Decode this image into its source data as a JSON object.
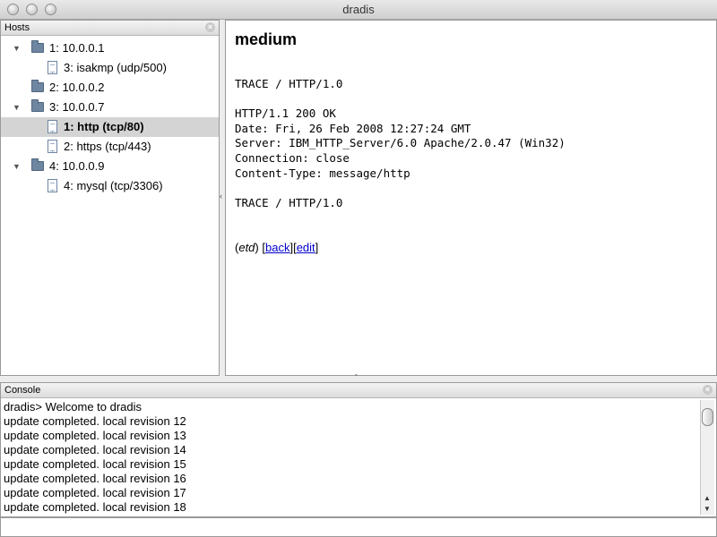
{
  "window": {
    "title": "dradis"
  },
  "hosts_panel": {
    "header": "Hosts",
    "tree": [
      {
        "label": "1: 10.0.0.1",
        "type": "folder",
        "level": 0,
        "expanded": true
      },
      {
        "label": "3: isakmp (udp/500)",
        "type": "doc",
        "level": 1
      },
      {
        "label": "2: 10.0.0.2",
        "type": "folder",
        "level": 0,
        "expanded": false
      },
      {
        "label": "3: 10.0.0.7",
        "type": "folder",
        "level": 0,
        "expanded": true
      },
      {
        "label": "1: http (tcp/80)",
        "type": "doc",
        "level": 1,
        "selected": true
      },
      {
        "label": "2: https (tcp/443)",
        "type": "doc",
        "level": 1
      },
      {
        "label": "4: 10.0.0.9",
        "type": "folder",
        "level": 0,
        "expanded": true
      },
      {
        "label": "4: mysql (tcp/3306)",
        "type": "doc",
        "level": 1
      }
    ]
  },
  "note": {
    "title": "medium",
    "body": "TRACE / HTTP/1.0\n\nHTTP/1.1 200 OK\nDate: Fri, 26 Feb 2008 12:27:24 GMT\nServer: IBM_HTTP_Server/6.0 Apache/2.0.47 (Win32)\nConnection: close\nContent-Type: message/http\n\nTRACE / HTTP/1.0",
    "author": "etd",
    "back_label": "back",
    "edit_label": "edit"
  },
  "console_panel": {
    "header": "Console",
    "lines": [
      "dradis> Welcome to dradis",
      "update completed. local revision 12",
      "update completed. local revision 13",
      "update completed. local revision 14",
      "update completed. local revision 15",
      "update completed. local revision 16",
      "update completed. local revision 17",
      "update completed. local revision 18"
    ]
  },
  "icons": {
    "close": "close-icon",
    "folder": "folder-icon",
    "document": "document-icon",
    "disclosure_open": "disclosure-open-icon",
    "disclosure_closed": "disclosure-closed-icon"
  },
  "colors": {
    "selection": "#d4d4d4",
    "folder": "#6f86a1",
    "link": "#0000cc"
  }
}
